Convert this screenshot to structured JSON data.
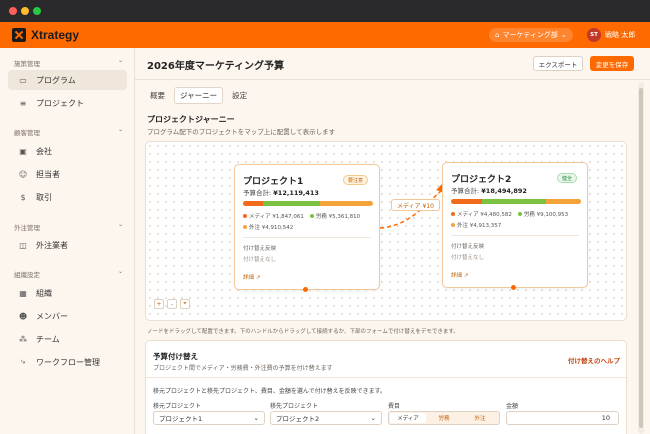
{
  "app": {
    "name": "Xtrategy",
    "department": "マーケティング部",
    "user_initials": "ST",
    "user_name": "戦略 太郎"
  },
  "sidebar": {
    "sections": [
      {
        "title": "施策管理",
        "items": [
          {
            "label": "プログラム",
            "icon": "folder-icon",
            "active": true
          },
          {
            "label": "プロジェクト",
            "icon": "list-icon"
          }
        ]
      },
      {
        "title": "顧客管理",
        "items": [
          {
            "label": "会社",
            "icon": "building-icon"
          },
          {
            "label": "担当者",
            "icon": "users-icon"
          },
          {
            "label": "取引",
            "icon": "dollar-icon"
          }
        ]
      },
      {
        "title": "外注管理",
        "items": [
          {
            "label": "外注業者",
            "icon": "briefcase-icon"
          }
        ]
      },
      {
        "title": "組織設定",
        "items": [
          {
            "label": "組織",
            "icon": "org-icon"
          },
          {
            "label": "メンバー",
            "icon": "user-icon"
          },
          {
            "label": "チーム",
            "icon": "team-icon"
          },
          {
            "label": "ワークフロー管理",
            "icon": "workflow-icon"
          }
        ]
      }
    ]
  },
  "header": {
    "title": "2026年度マーケティング予算",
    "export_label": "エクスポート",
    "save_label": "変更を保存"
  },
  "tabs": [
    {
      "label": "概要"
    },
    {
      "label": "ジャーニー",
      "active": true
    },
    {
      "label": "設定"
    }
  ],
  "journey": {
    "title": "プロジェクトジャーニー",
    "subtitle": "プログラム配下のプロジェクトをマップ上に配置して表示します",
    "hint": "ノードをドラッグして配置できます。下のハンドルからドラッグして接続するか、下部のフォームで付け替えをデモできます。",
    "edge_label": "メディア ¥10",
    "zoom": {
      "in": "+",
      "out": "-",
      "fit": "⌖"
    },
    "nodes": [
      {
        "name": "プロジェクト1",
        "total_label": "予算合計:",
        "total": "¥12,119,413",
        "status": "要注意",
        "status_type": "warn",
        "media_label": "メディア",
        "media": "¥1,847,061",
        "labor_label": "労務",
        "labor": "¥5,361,810",
        "outsource_label": "外注",
        "outsource": "¥4,910,542",
        "share": {
          "media": 0.152,
          "labor": 0.442,
          "outsource": 0.405
        },
        "reassign_label": "付け替え反映",
        "reassign_value": "付け替えなし",
        "detail": "詳細 ↗"
      },
      {
        "name": "プロジェクト2",
        "total_label": "予算合計:",
        "total": "¥18,494,892",
        "status": "健全",
        "status_type": "ok",
        "media_label": "メディア",
        "media": "¥4,480,582",
        "labor_label": "労務",
        "labor": "¥9,100,953",
        "outsource_label": "外注",
        "outsource": "¥4,913,357",
        "share": {
          "media": 0.242,
          "labor": 0.492,
          "outsource": 0.266
        },
        "reassign_label": "付け替え反映",
        "reassign_value": "付け替えなし",
        "detail": "詳細 ↗"
      }
    ]
  },
  "reassign": {
    "title": "予算付け替え",
    "subtitle": "プロジェクト間でメディア・労務費・外注費の予算を付け替えます",
    "help": "付け替えのヘルプ",
    "description": "移元プロジェクトと移先プロジェクト、費目、金額を選んで付け替えを反映できます。",
    "source_label": "移元プロジェクト",
    "source_value": "プロジェクト1",
    "target_label": "移先プロジェクト",
    "target_value": "プロジェクト2",
    "category_label": "費目",
    "categories": [
      "メディア",
      "労務",
      "外注"
    ],
    "selected_category": "メディア",
    "amount_label": "金額",
    "amount_value": "10"
  },
  "colors": {
    "brand": "#ff6a00",
    "media": "#f26b1d",
    "labor": "#7cc242",
    "outsource": "#f3a33a"
  }
}
